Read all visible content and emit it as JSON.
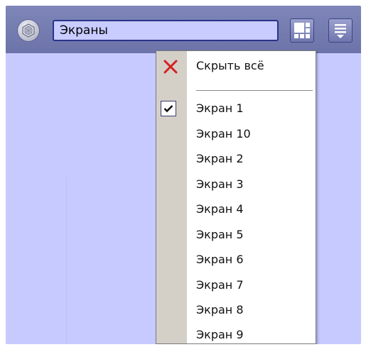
{
  "toolbar": {
    "title": "Экраны",
    "logo_icon": "hexagon-logo-icon",
    "layouts_icon": "layout-grid-icon",
    "menu_icon": "menu-list-icon"
  },
  "dropdown": {
    "hide_all_label": "Скрыть всё",
    "hide_all_icon": "red-x-icon",
    "check_icon": "checkmark-icon",
    "items": [
      {
        "label": "Экран 1",
        "checked": true
      },
      {
        "label": "Экран 10",
        "checked": false
      },
      {
        "label": "Экран 2",
        "checked": false
      },
      {
        "label": "Экран 3",
        "checked": false
      },
      {
        "label": "Экран 4",
        "checked": false
      },
      {
        "label": "Экран 5",
        "checked": false
      },
      {
        "label": "Экран 6",
        "checked": false
      },
      {
        "label": "Экран 7",
        "checked": false
      },
      {
        "label": "Экран 8",
        "checked": false
      },
      {
        "label": "Экран 9",
        "checked": false
      }
    ]
  },
  "colors": {
    "toolbar": "#7479b0",
    "workspace": "#c6caff",
    "title_field": "#c8ccff",
    "menu_gutter": "#d4d0c8",
    "hide_icon": "#d42020"
  }
}
